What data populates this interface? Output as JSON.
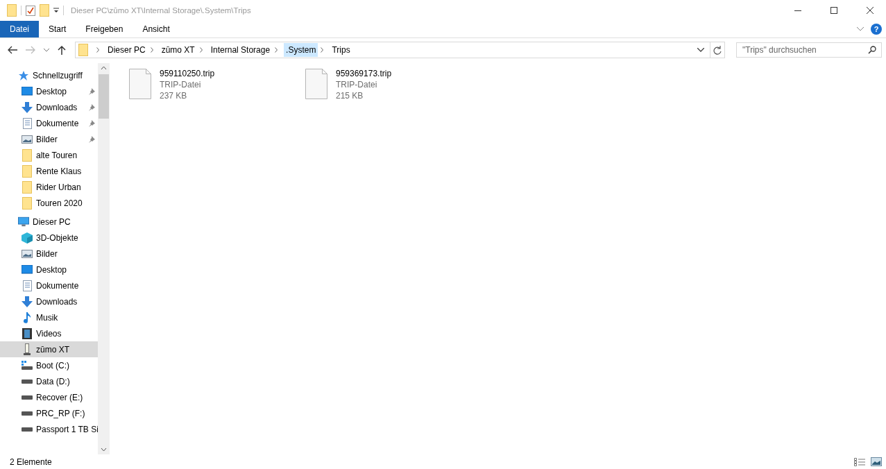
{
  "window": {
    "title": "Dieser PC\\zūmo XT\\Internal Storage\\.System\\Trips"
  },
  "ribbon_tabs": [
    {
      "label": "Datei",
      "selected": true
    },
    {
      "label": "Start",
      "selected": false
    },
    {
      "label": "Freigeben",
      "selected": false
    },
    {
      "label": "Ansicht",
      "selected": false
    }
  ],
  "help": {
    "label": "?"
  },
  "breadcrumb": [
    {
      "label": "Dieser PC",
      "selected": false
    },
    {
      "label": "zūmo XT",
      "selected": false
    },
    {
      "label": "Internal Storage",
      "selected": false
    },
    {
      "label": ".System",
      "selected": true
    },
    {
      "label": "Trips",
      "selected": false
    }
  ],
  "search": {
    "placeholder": "\"Trips\" durchsuchen"
  },
  "sidebar": {
    "items": [
      {
        "label": "Schnellzugriff",
        "kind": "star",
        "selected": false,
        "children": [
          {
            "label": "Desktop",
            "kind": "desktop",
            "pinned": true,
            "selected": false
          },
          {
            "label": "Downloads",
            "kind": "download",
            "pinned": true,
            "selected": false
          },
          {
            "label": "Dokumente",
            "kind": "document",
            "pinned": true,
            "selected": false
          },
          {
            "label": "Bilder",
            "kind": "image",
            "pinned": true,
            "selected": false
          },
          {
            "label": "alte Touren",
            "kind": "folder",
            "pinned": false,
            "selected": false
          },
          {
            "label": "Rente Klaus",
            "kind": "folder",
            "pinned": false,
            "selected": false
          },
          {
            "label": "Rider Urban",
            "kind": "folder",
            "pinned": false,
            "selected": false
          },
          {
            "label": "Touren 2020",
            "kind": "folder",
            "pinned": false,
            "selected": false
          }
        ]
      },
      {
        "label": "Dieser PC",
        "kind": "pc",
        "selected": false,
        "children": [
          {
            "label": "3D-Objekte",
            "kind": "cube",
            "pinned": false,
            "selected": false
          },
          {
            "label": "Bilder",
            "kind": "image",
            "pinned": false,
            "selected": false
          },
          {
            "label": "Desktop",
            "kind": "desktop",
            "pinned": false,
            "selected": false
          },
          {
            "label": "Dokumente",
            "kind": "document",
            "pinned": false,
            "selected": false
          },
          {
            "label": "Downloads",
            "kind": "download",
            "pinned": false,
            "selected": false
          },
          {
            "label": "Musik",
            "kind": "music",
            "pinned": false,
            "selected": false
          },
          {
            "label": "Videos",
            "kind": "video",
            "pinned": false,
            "selected": false
          },
          {
            "label": "zūmo XT",
            "kind": "device",
            "pinned": false,
            "selected": true
          },
          {
            "label": "Boot (C:)",
            "kind": "osdrive",
            "pinned": false,
            "selected": false
          },
          {
            "label": "Data (D:)",
            "kind": "drive",
            "pinned": false,
            "selected": false
          },
          {
            "label": "Recover (E:)",
            "kind": "drive",
            "pinned": false,
            "selected": false
          },
          {
            "label": "PRC_RP (F:)",
            "kind": "drive",
            "pinned": false,
            "selected": false
          },
          {
            "label": "Passport 1 TB Si",
            "kind": "drive",
            "pinned": false,
            "selected": false
          }
        ]
      }
    ]
  },
  "files": [
    {
      "name": "959110250.trip",
      "type": "TRIP-Datei",
      "size": "237 KB"
    },
    {
      "name": "959369173.trip",
      "type": "TRIP-Datei",
      "size": "215 KB"
    }
  ],
  "status_bar": {
    "count": "2 Elemente"
  }
}
